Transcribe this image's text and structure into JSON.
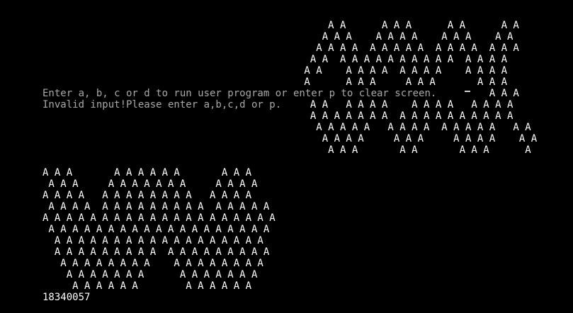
{
  "colors": {
    "background": "#000000",
    "pattern_text": "#ffffff",
    "console_text": "#a8a8a8"
  },
  "top_right_pattern": [
    "     A A      A A A      A A      A A",
    "    A A A    A A A A    A A A    A A",
    "   A A A A  A A A A A  A A A A  A A A",
    "  A A  A A A A A A A A A A  A A A A",
    " A A    A A A A  A A A A    A A A A",
    " A      A A A     A A A       A A A",
    "                                A A A",
    "  A A   A A A A    A A A A   A A A A",
    "  A A A A A A A  A A A A A A A A A A",
    "   A A A A A   A A A A  A A A A A   A A",
    "    A A A A     A A A     A A A A    A A",
    "     A A A       A A       A A A      A"
  ],
  "console": {
    "prompt_line": "Enter a, b, c or d to run user program or enter p to clear screen.",
    "error_line": "Invalid input!Please enter a,b,c,d or p."
  },
  "bottom_left_pattern": [
    "A A A       A A A A A A       A A A",
    " A A A     A A A A A A A     A A A A",
    "A A A A   A A A A A A A A   A A A A",
    " A A A A  A A A A A A A A A  A A A A A",
    "A A A A A A A A A A A A A A A A A A A A",
    " A A A A A A A A A A A A A A A A A A A",
    "  A A A A A A A A A A A A A A A A A A",
    "  A A A A A A A A A  A A A A A A A A A",
    "   A A A A A A A A    A A A A A A A A",
    "    A A A A A A A      A A A A A A A",
    "     A A A A A A        A A A A A A"
  ],
  "student_id": "18340057"
}
